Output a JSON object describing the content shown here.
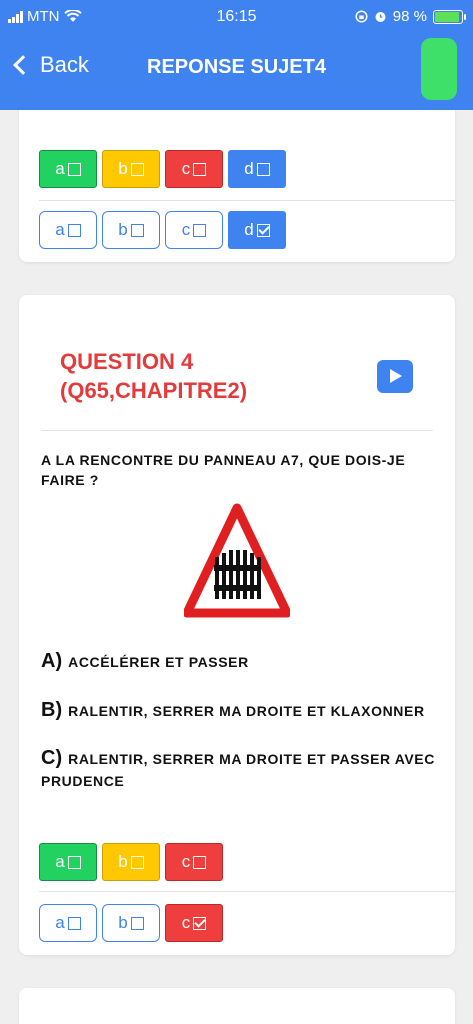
{
  "status_bar": {
    "carrier": "MTN",
    "time": "16:15",
    "battery": "98 %"
  },
  "nav": {
    "back_label": "Back",
    "title": "REPONSE SUJET4"
  },
  "card_prev": {
    "answer_row": [
      {
        "letter": "a",
        "checked": false
      },
      {
        "letter": "b",
        "checked": false
      },
      {
        "letter": "c",
        "checked": false
      },
      {
        "letter": "d",
        "checked": false
      }
    ],
    "user_row": [
      {
        "letter": "a",
        "checked": false
      },
      {
        "letter": "b",
        "checked": false
      },
      {
        "letter": "c",
        "checked": false
      },
      {
        "letter": "d",
        "checked": true
      }
    ]
  },
  "question": {
    "title_line1": "QUESTION 4",
    "title_line2": "(Q65,CHAPITRE2)",
    "text": "A LA RENCONTRE DU PANNEAU A7, QUE DOIS-JE FAIRE ?",
    "image": "level-crossing-warning-sign",
    "answers": [
      {
        "letter": "A)",
        "text": "ACCÉLÉRER ET PASSER"
      },
      {
        "letter": "B)",
        "text": "RALENTIR, SERRER MA DROITE ET KLAXONNER"
      },
      {
        "letter": "C)",
        "text": "RALENTIR, SERRER MA DROITE ET PASSER AVEC PRUDENCE"
      }
    ],
    "answer_row": [
      {
        "letter": "a",
        "checked": false
      },
      {
        "letter": "b",
        "checked": false
      },
      {
        "letter": "c",
        "checked": false
      }
    ],
    "user_row": [
      {
        "letter": "a",
        "checked": false
      },
      {
        "letter": "b",
        "checked": false
      },
      {
        "letter": "c",
        "checked": true
      }
    ]
  },
  "colors": {
    "header": "#3f83f0",
    "question_title": "#e33b3b",
    "option_green": "#21d260",
    "option_yellow": "#ffc800",
    "option_red": "#ef3e3e",
    "option_blue": "#3f83f0"
  }
}
